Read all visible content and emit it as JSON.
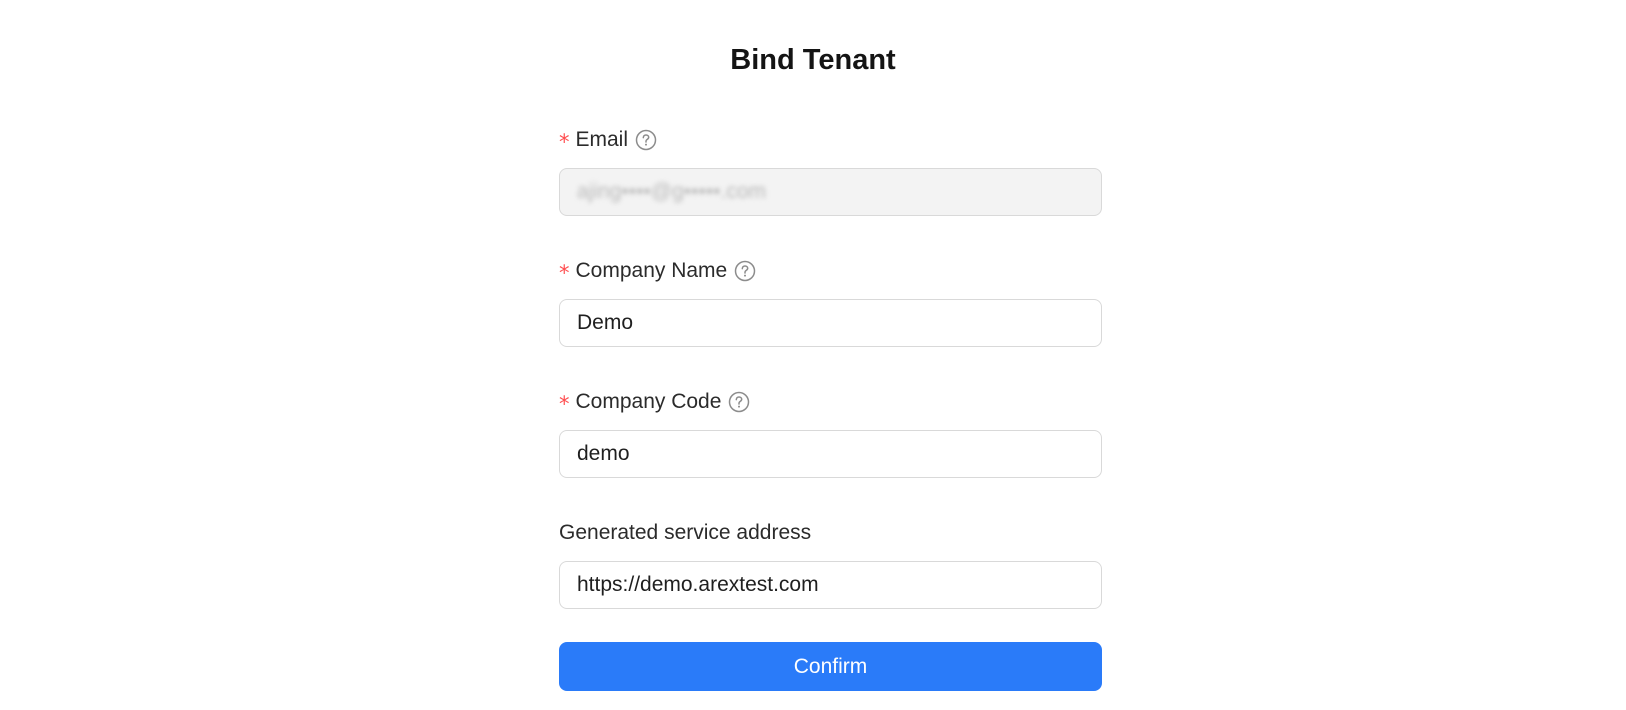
{
  "page": {
    "title": "Bind Tenant"
  },
  "form": {
    "email": {
      "label": "Email",
      "required": "*",
      "value": "ajing••••@g•••••.com",
      "disabled": true
    },
    "company_name": {
      "label": "Company Name",
      "required": "*",
      "value": "Demo"
    },
    "company_code": {
      "label": "Company Code",
      "required": "*",
      "value": "demo"
    },
    "service_address": {
      "label": "Generated service address",
      "value": "https://demo.arextest.com"
    },
    "confirm_label": "Confirm"
  },
  "colors": {
    "primary": "#2a7bf9",
    "required": "#ff4d4f",
    "border": "#d9d9d9",
    "disabled_bg": "#f3f3f3"
  },
  "icons": {
    "help": "question-circle-icon"
  }
}
